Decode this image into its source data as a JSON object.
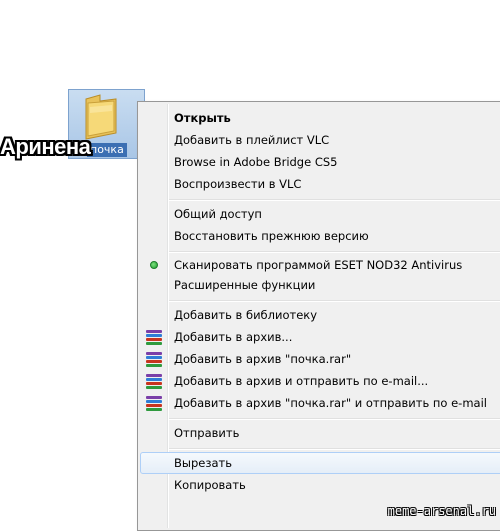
{
  "desktop": {
    "folder_name": "почка",
    "overlay_caption": "Аринена"
  },
  "menu": {
    "items": [
      {
        "label": "Открыть",
        "bold": true
      },
      {
        "label": "Добавить в плейлист VLC"
      },
      {
        "label": "Browse in Adobe Bridge CS5"
      },
      {
        "label": "Воспроизвести в VLC"
      },
      {
        "label": "Общий доступ",
        "submenu": true
      },
      {
        "label": "Восстановить прежнюю версию"
      },
      {
        "label": "Сканировать программой ESET NOD32 Antivirus",
        "icon": "eset-radio-icon"
      },
      {
        "label": "Расширенные функции",
        "submenu": true
      },
      {
        "label": "Добавить в библиотеку",
        "submenu": true
      },
      {
        "label": "Добавить в архив...",
        "icon": "winrar-icon"
      },
      {
        "label": "Добавить в архив \"почка.rar\"",
        "icon": "winrar-icon"
      },
      {
        "label": "Добавить в архив и отправить по e-mail...",
        "icon": "winrar-icon"
      },
      {
        "label": "Добавить в архив \"почка.rar\" и отправить по e-mail",
        "icon": "winrar-icon"
      },
      {
        "label": "Отправить",
        "submenu": true
      },
      {
        "label": "Вырезать",
        "hover": true
      },
      {
        "label": "Копировать"
      }
    ]
  },
  "watermark": "meme-arsenal.ru",
  "colors": {
    "menu_bg": "#f0f0f0",
    "hover_border": "#aecff7",
    "selection_blue": "#3b6fb3"
  }
}
